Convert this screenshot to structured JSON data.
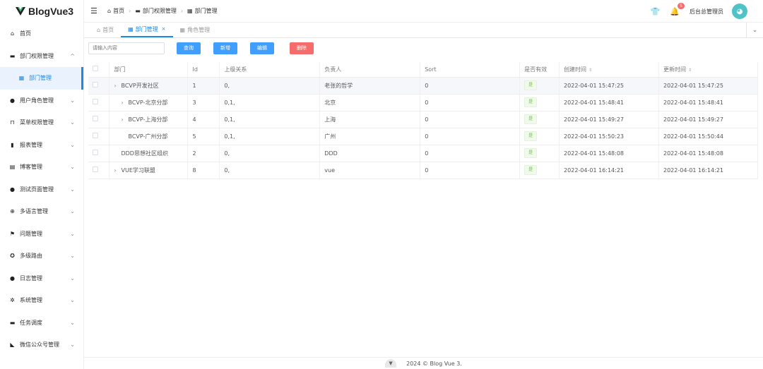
{
  "app": {
    "logo_text": "BlogVue3"
  },
  "sidebar": {
    "items": [
      {
        "label": "首页",
        "icon": "home-icon",
        "glyph": "⌂"
      },
      {
        "label": "部门权限管理",
        "icon": "briefcase-icon",
        "glyph": "▬",
        "chev": "^"
      },
      {
        "label": "部门管理",
        "icon": "grid-icon",
        "glyph": "▦",
        "sub": true
      },
      {
        "label": "用户角色管理",
        "icon": "user-icon",
        "glyph": "●",
        "chev": "⌄"
      },
      {
        "label": "菜单权限管理",
        "icon": "lock-icon",
        "glyph": "⊓",
        "chev": "⌄"
      },
      {
        "label": "报表管理",
        "icon": "bar-chart-icon",
        "glyph": "▮",
        "chev": "⌄"
      },
      {
        "label": "博客管理",
        "icon": "document-icon",
        "glyph": "▤",
        "chev": "⌄"
      },
      {
        "label": "测试页面管理",
        "icon": "info-icon",
        "glyph": "●",
        "chev": "⌄"
      },
      {
        "label": "多语言管理",
        "icon": "plus-circle-icon",
        "glyph": "⊕",
        "chev": "⌄"
      },
      {
        "label": "问题管理",
        "icon": "flag-icon",
        "glyph": "⚑",
        "chev": "⌄"
      },
      {
        "label": "多级路由",
        "icon": "aperture-icon",
        "glyph": "✪",
        "chev": "⌄"
      },
      {
        "label": "日志管理",
        "icon": "user-log-icon",
        "glyph": "●",
        "chev": "⌄"
      },
      {
        "label": "系统管理",
        "icon": "gear-icon",
        "glyph": "✲",
        "chev": "⌄"
      },
      {
        "label": "任务调度",
        "icon": "ticket-icon",
        "glyph": "▬",
        "chev": "⌄"
      },
      {
        "label": "微信公众号管理",
        "icon": "wechat-icon",
        "glyph": "◣",
        "chev": "⌄"
      }
    ]
  },
  "header": {
    "breadcrumb": [
      "首页",
      "部门权限管理",
      "部门管理"
    ],
    "badge_count": "5",
    "username": "后台总管理员"
  },
  "tabs": [
    {
      "label": "首页",
      "active": false
    },
    {
      "label": "部门管理",
      "active": true,
      "close": "×"
    },
    {
      "label": "角色管理",
      "active": false
    }
  ],
  "toolbar": {
    "search_placeholder": "请输入内容",
    "query": "查询",
    "add": "新增",
    "edit": "编辑",
    "delete": "删除"
  },
  "table": {
    "columns": [
      "部门",
      "Id",
      "上级关系",
      "负责人",
      "Sort",
      "是否有效",
      "创建时间",
      "更新时间"
    ],
    "rows": [
      {
        "dept": "BCVP开发社区",
        "indent": 0,
        "expand": true,
        "id": "1",
        "parent": "0,",
        "owner": "老张的哲学",
        "sort": "0",
        "valid": "是",
        "created": "2022-04-01 15:47:25",
        "updated": "2022-04-01 15:47:25"
      },
      {
        "dept": "BCVP-北京分部",
        "indent": 1,
        "expand": true,
        "id": "3",
        "parent": "0,1,",
        "owner": "北京",
        "sort": "0",
        "valid": "是",
        "created": "2022-04-01 15:48:41",
        "updated": "2022-04-01 15:48:41"
      },
      {
        "dept": "BCVP-上海分部",
        "indent": 1,
        "expand": true,
        "id": "4",
        "parent": "0,1,",
        "owner": "上海",
        "sort": "0",
        "valid": "是",
        "created": "2022-04-01 15:49:27",
        "updated": "2022-04-01 15:49:27"
      },
      {
        "dept": "BCVP-广州分部",
        "indent": 1,
        "expand": false,
        "id": "5",
        "parent": "0,1,",
        "owner": "广州",
        "sort": "0",
        "valid": "是",
        "created": "2022-04-01 15:50:23",
        "updated": "2022-04-01 15:50:44"
      },
      {
        "dept": "DDD思想社区组织",
        "indent": 0,
        "expand": false,
        "id": "2",
        "parent": "0,",
        "owner": "DDD",
        "sort": "0",
        "valid": "是",
        "created": "2022-04-01 15:48:08",
        "updated": "2022-04-01 15:48:08"
      },
      {
        "dept": "VUE学习联盟",
        "indent": 0,
        "expand": true,
        "id": "8",
        "parent": "0,",
        "owner": "vue",
        "sort": "0",
        "valid": "是",
        "created": "2022-04-01 16:14:21",
        "updated": "2022-04-01 16:14:21"
      }
    ]
  },
  "footer": {
    "text": "2024 © Blog Vue 3."
  },
  "colors": {
    "primary": "#409eff",
    "danger": "#f56c6c",
    "success": "#67c23a"
  }
}
